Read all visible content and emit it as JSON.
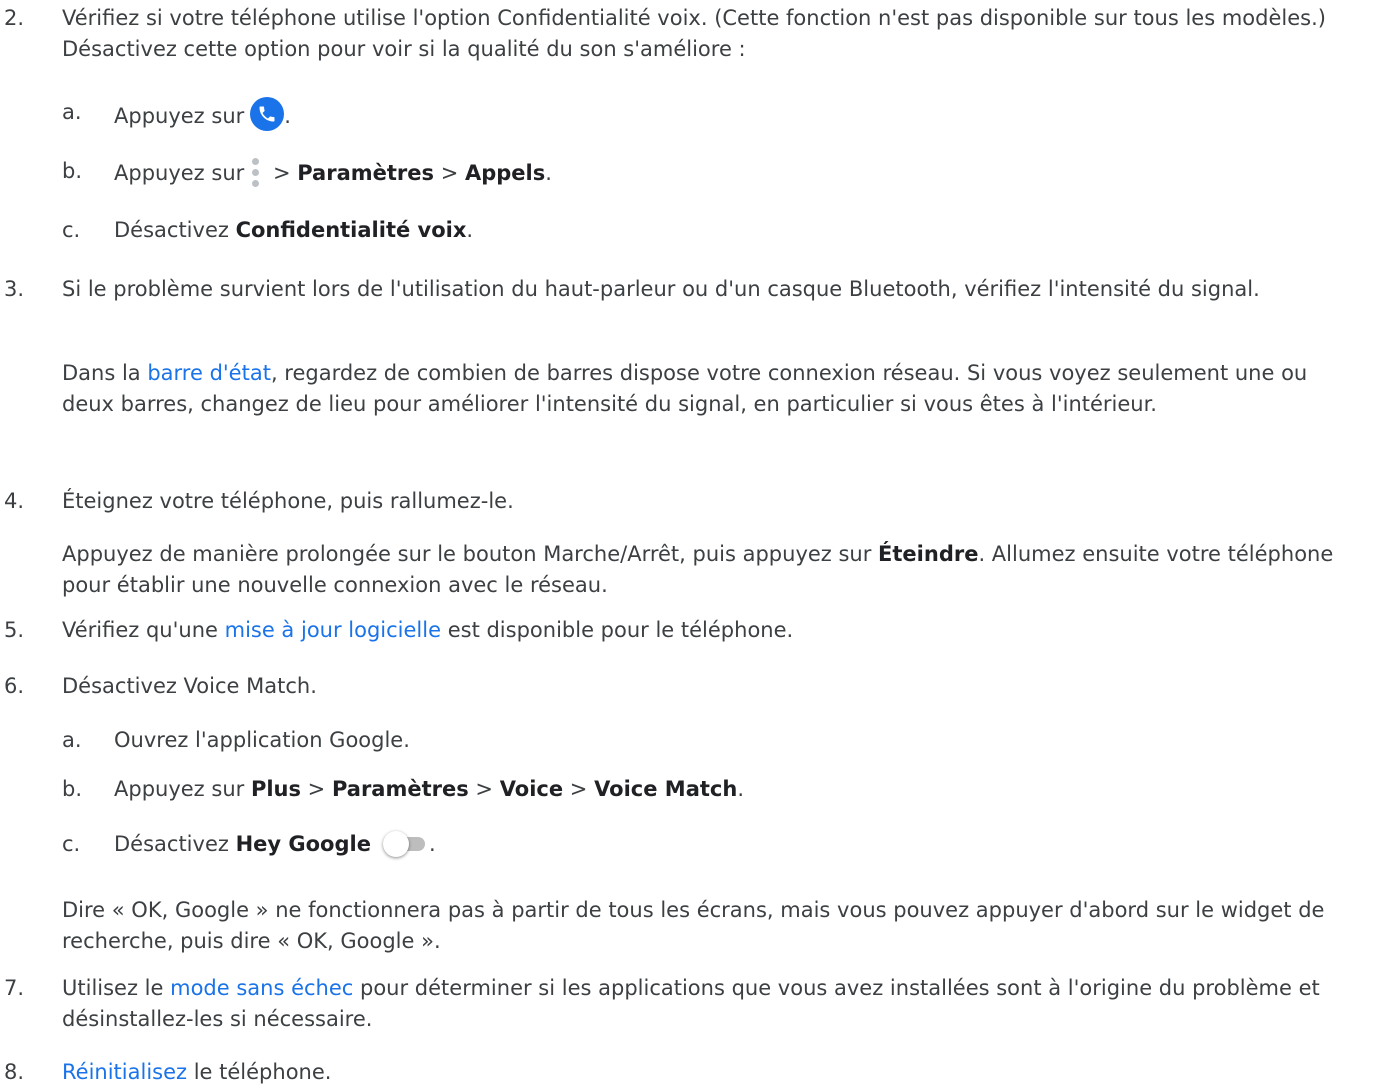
{
  "steps": {
    "s2": {
      "num": "2.",
      "text": "Vérifiez si votre téléphone utilise l'option Confidentialité voix. (Cette fonction n'est pas disponible sur tous les modèles.) Désactivez cette option pour voir si la qualité du son s'améliore :",
      "a": {
        "label": "a.",
        "t1": "Appuyez sur",
        "t2": "."
      },
      "b": {
        "label": "b.",
        "t1": "Appuyez sur",
        "sep1": " > ",
        "b1": "Paramètres",
        "sep2": " > ",
        "b2": "Appels",
        "end": "."
      },
      "c": {
        "label": "c.",
        "t1": "Désactivez ",
        "b1": "Confidentialité voix",
        "end": "."
      }
    },
    "s3": {
      "num": "3.",
      "text": "Si le problème survient lors de l'utilisation du haut-parleur ou d'un casque Bluetooth, vérifiez l'intensité du signal.",
      "p1": "Dans la ",
      "link": "barre d'état",
      "p2": ", regardez de combien de barres dispose votre connexion réseau. Si vous voyez seulement une ou deux barres, changez de lieu pour améliorer l'intensité du signal, en particulier si vous êtes à l'intérieur."
    },
    "s4": {
      "num": "4.",
      "text": "Éteignez votre téléphone, puis rallumez-le.",
      "p1": "Appuyez de manière prolongée sur le bouton Marche/Arrêt, puis appuyez sur ",
      "b1": "Éteindre",
      "p2": ". Allumez ensuite votre téléphone pour établir une nouvelle connexion avec le réseau."
    },
    "s5": {
      "num": "5.",
      "t1": "Vérifiez qu'une ",
      "link": "mise à jour logicielle",
      "t2": " est disponible pour le téléphone."
    },
    "s6": {
      "num": "6.",
      "text": "Désactivez Voice Match.",
      "a": {
        "label": "a.",
        "t1": "Ouvrez l'application Google."
      },
      "b": {
        "label": "b.",
        "t1": "Appuyez sur ",
        "b1": "Plus",
        "sep1": " > ",
        "b2": "Paramètres",
        "sep2": " > ",
        "b3": "Voice",
        "sep3": " > ",
        "b4": "Voice Match",
        "end": "."
      },
      "c": {
        "label": "c.",
        "t1": "Désactivez ",
        "b1": "Hey Google",
        "end": "."
      },
      "note": "Dire « OK, Google » ne fonctionnera pas à partir de tous les écrans, mais vous pouvez appuyer d'abord sur le widget de recherche, puis dire « OK, Google »."
    },
    "s7": {
      "num": "7.",
      "t1": "Utilisez le ",
      "link": "mode sans échec",
      "t2": " pour déterminer si les applications que vous avez installées sont à l'origine du problème et désinstallez-les si nécessaire."
    },
    "s8": {
      "num": "8.",
      "link": "Réinitialisez",
      "t2": " le téléphone."
    }
  },
  "icons": {
    "phone": "phone-app-icon",
    "menu": "more-vert-icon",
    "toggle": "toggle-off-icon"
  },
  "colors": {
    "link": "#1a73e8",
    "text": "#3c4043",
    "phone_icon_bg": "#1a73e8"
  }
}
